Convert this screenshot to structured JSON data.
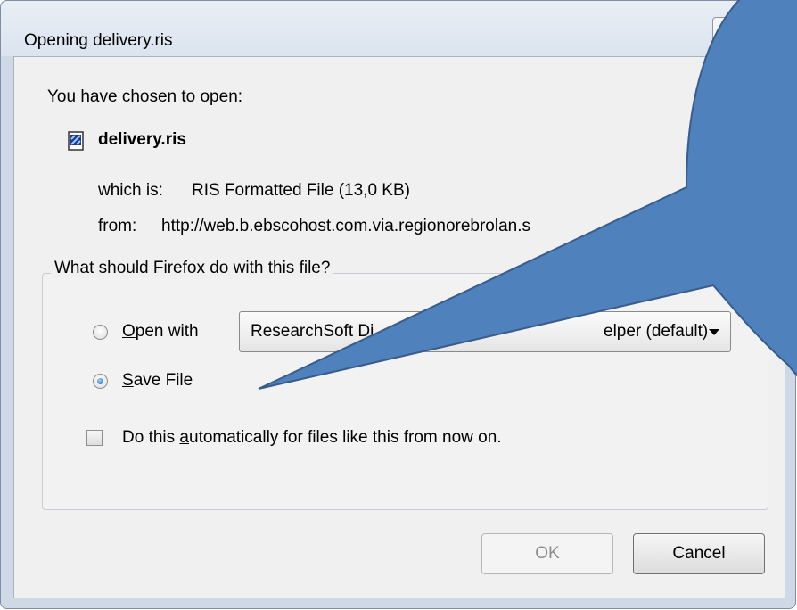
{
  "window": {
    "title": "Opening delivery.ris"
  },
  "dialog": {
    "intro": "You have chosen to open:",
    "filename": "delivery.ris",
    "type_label": "which is:",
    "type_value": "RIS Formatted File (13,0 KB)",
    "from_label": "from:",
    "from_value": "http://web.b.ebscohost.com.via.regionorebrolan.s",
    "group_legend": "What should Firefox do with this file?",
    "open_with": {
      "accesskey": "O",
      "rest": "pen with",
      "selected": false
    },
    "app_select": {
      "value": "ResearchSoft Di",
      "value_tail": "elper (default)"
    },
    "save_file": {
      "accesskey": "S",
      "rest": "ave File",
      "selected": true
    },
    "auto_checkbox": {
      "pre": "Do this ",
      "accesskey": "a",
      "rest": "utomatically for files like this from now on.",
      "checked": false
    },
    "ok_label": "OK",
    "cancel_label": "Cancel"
  },
  "callout": {
    "fill": "#4f81bd",
    "stroke": "#385d8a"
  },
  "icons": {
    "file": "file-icon",
    "dropdown": "chevron-down-icon"
  }
}
